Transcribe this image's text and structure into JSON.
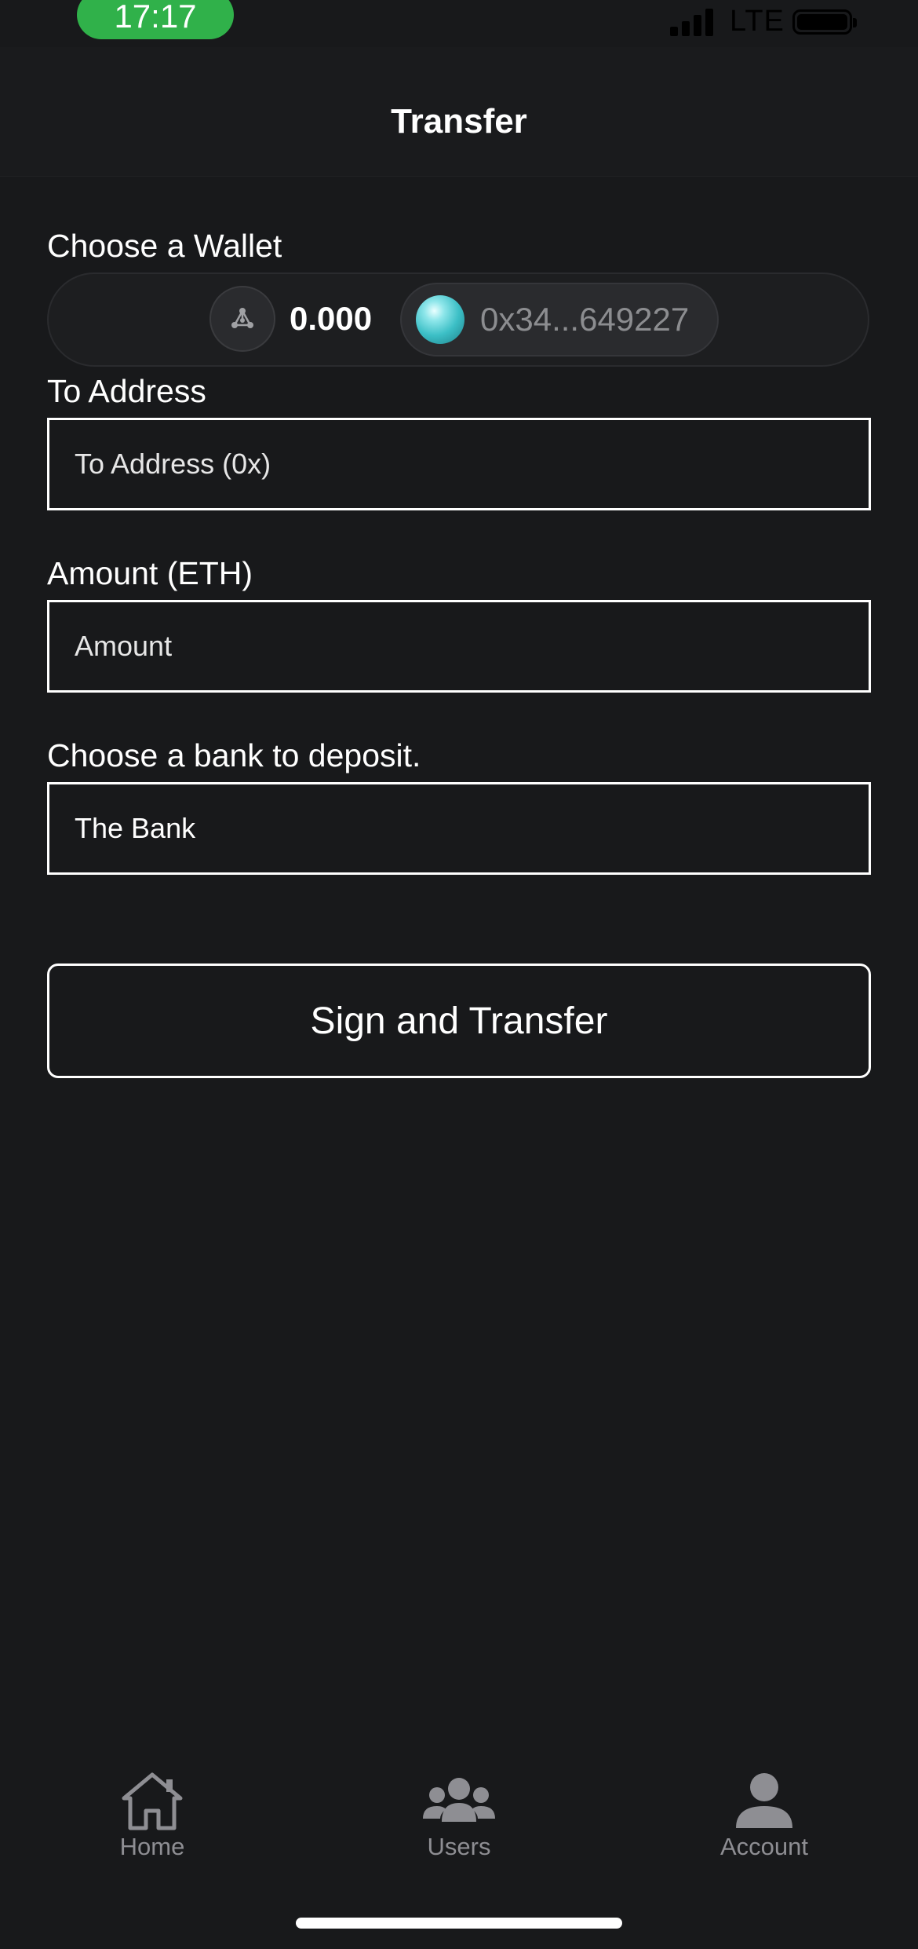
{
  "status_bar": {
    "time": "17:17",
    "network": "LTE"
  },
  "header": {
    "title": "Transfer"
  },
  "form": {
    "wallet": {
      "label": "Choose a Wallet",
      "balance": "0.000",
      "address": "0x34...649227",
      "network_icon": "network-nodes-icon"
    },
    "to_address": {
      "label": "To Address",
      "placeholder": "To Address (0x)",
      "value": ""
    },
    "amount": {
      "label": "Amount (ETH)",
      "placeholder": "Amount",
      "value": ""
    },
    "bank": {
      "label": "Choose a bank to deposit.",
      "value": "The Bank"
    },
    "submit_label": "Sign and Transfer"
  },
  "tab_bar": {
    "items": [
      {
        "label": "Home",
        "icon": "home-icon"
      },
      {
        "label": "Users",
        "icon": "users-icon"
      },
      {
        "label": "Account",
        "icon": "account-icon"
      }
    ]
  },
  "colors": {
    "background": "#18191b",
    "status_pill": "#30b14a",
    "muted_text": "#8c8d90",
    "tab_inactive": "#8e8e93"
  }
}
